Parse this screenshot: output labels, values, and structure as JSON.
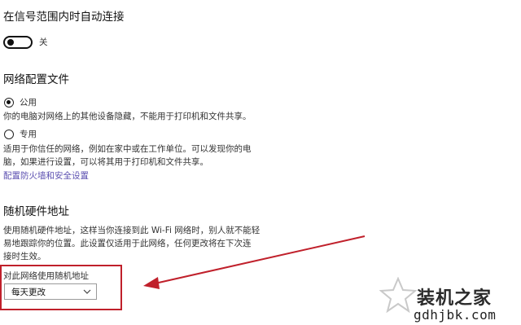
{
  "auto_connect": {
    "heading": "在信号范围内时自动连接",
    "toggle_label": "关",
    "toggle_state": "off"
  },
  "network_profile": {
    "heading": "网络配置文件",
    "options": [
      {
        "label": "公用",
        "selected": true,
        "description": "你的电脑对网络上的其他设备隐藏，不能用于打印机和文件共享。"
      },
      {
        "label": "专用",
        "selected": false,
        "description_lines": [
          "适用于你信任的网络，例如在家中或在工作单位。可以发现你的电",
          "脑，如果进行设置，可以将其用于打印机和文件共享。"
        ]
      }
    ],
    "firewall_link": "配置防火墙和安全设置"
  },
  "random_hw": {
    "heading": "随机硬件地址",
    "description_lines": [
      "使用随机硬件地址，这样当你连接到此 Wi-Fi 网络时，别人就不能轻",
      "易地跟踪你的位置。此设置仅适用于此网络，任何更改将在下次连",
      "接时生效。"
    ],
    "select_label": "对此网络使用随机地址",
    "select_value": "每天更改"
  },
  "annotation": {
    "color": "#c0202b"
  },
  "watermark": {
    "name": "装机之家",
    "url": "gdhjbk.com"
  }
}
